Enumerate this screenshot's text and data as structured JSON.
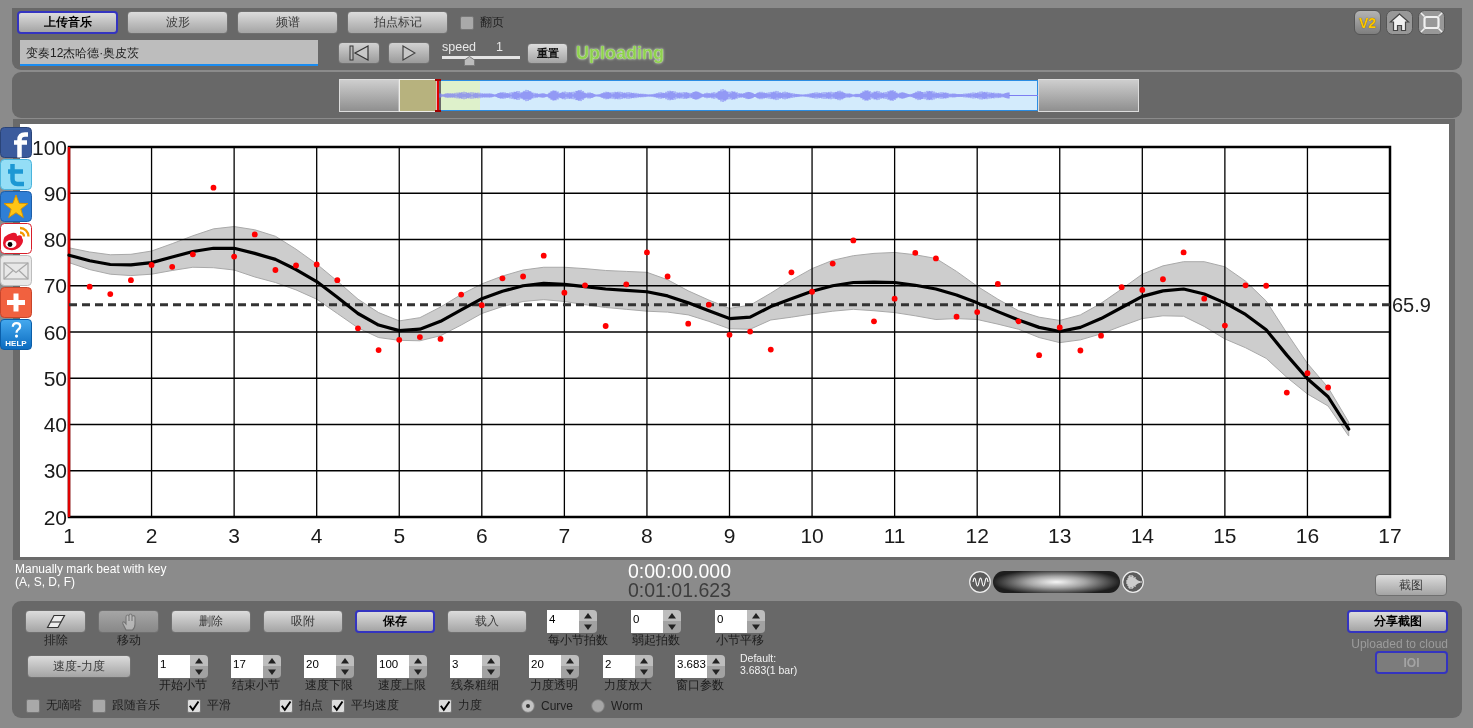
{
  "toolbar": {
    "tabs": [
      {
        "label": "上传音乐",
        "selected": true
      },
      {
        "label": "波形",
        "selected": false
      },
      {
        "label": "频谱",
        "selected": false
      },
      {
        "label": "拍点标记",
        "selected": false
      }
    ],
    "page_flip": {
      "label": "翻页",
      "checked": false
    },
    "version_label": "V2"
  },
  "track": {
    "title": "变奏12杰哈德·奥皮茨",
    "speed_label": "speed",
    "speed_value": "1",
    "speed": {
      "level": 0.33
    },
    "reset_label": "重置",
    "status": "Uploading"
  },
  "social_bar": {
    "help_caption": "HELP"
  },
  "chart": {
    "chart_data": {
      "type": "scatter",
      "grid": true,
      "xlim": [
        1,
        17
      ],
      "ylim": [
        20,
        100
      ],
      "xticks": [
        1,
        2,
        3,
        4,
        5,
        6,
        7,
        8,
        9,
        10,
        11,
        12,
        13,
        14,
        15,
        16,
        17
      ],
      "yticks": [
        20,
        30,
        40,
        50,
        60,
        70,
        80,
        90,
        100
      ],
      "x": [
        1,
        1.25,
        1.5,
        1.75,
        2,
        2.25,
        2.5,
        2.75,
        3,
        3.25,
        3.5,
        3.75,
        4,
        4.25,
        4.5,
        4.75,
        5,
        5.25,
        5.5,
        5.75,
        6,
        6.25,
        6.5,
        6.75,
        7,
        7.25,
        7.5,
        7.75,
        8,
        8.25,
        8.5,
        8.75,
        9,
        9.25,
        9.5,
        9.75,
        10,
        10.25,
        10.5,
        10.75,
        11,
        11.25,
        11.5,
        11.75,
        12,
        12.25,
        12.5,
        12.75,
        13,
        13.25,
        13.5,
        13.75,
        14,
        14.25,
        14.5,
        14.75,
        15,
        15.25,
        15.5,
        15.75,
        16,
        16.25,
        16.5
      ],
      "series": [
        {
          "type": "line",
          "color": "#000000",
          "values": [
            76.6,
            75.4,
            74.6,
            74.5,
            75.0,
            76.2,
            77.4,
            78.1,
            78.1,
            77.0,
            75.7,
            73.5,
            70.9,
            67.5,
            64.0,
            61.5,
            60.3,
            60.6,
            62.3,
            64.8,
            67.2,
            68.8,
            70.0,
            70.5,
            70.3,
            69.8,
            69.3,
            69.0,
            68.7,
            67.8,
            66.3,
            64.6,
            62.9,
            63.2,
            65.5,
            67.2,
            68.8,
            70.0,
            70.7,
            70.8,
            70.7,
            70.1,
            69.3,
            68.0,
            66.3,
            64.4,
            62.6,
            61.0,
            60.1,
            61.0,
            62.9,
            65.3,
            67.7,
            68.9,
            69.3,
            68.2,
            66.3,
            63.8,
            60.5,
            55.0,
            49.9,
            46.0,
            39.0
          ]
        },
        {
          "color": "#ff0000",
          "values": [
            null,
            69.8,
            68.2,
            71.2,
            74.5,
            74.1,
            76.8,
            91.2,
            76.3,
            81.1,
            73.4,
            74.4,
            74.6,
            71.2,
            60.8,
            56.1,
            58.3,
            58.9,
            58.5,
            68.1,
            65.8,
            71.6,
            72.0,
            76.5,
            68.5,
            70.1,
            61.3,
            70.3,
            77.2,
            72.0,
            61.8,
            65.9,
            59.4,
            60.1,
            56.2,
            72.9,
            68.7,
            74.8,
            79.8,
            62.3,
            67.2,
            77.1,
            75.9,
            63.3,
            64.3,
            70.4,
            62.3,
            55.0,
            61.0,
            56.0,
            59.2,
            69.7,
            69.1,
            71.4,
            77.2,
            67.2,
            61.4,
            70.1,
            70.0,
            46.9,
            51.1,
            48.0,
            null
          ]
        }
      ],
      "ref_lines": [
        {
          "axis": "y",
          "value": 65.9,
          "label": "65.9"
        }
      ]
    }
  },
  "hint": "Manually mark beat with key\n(A, S, D, F)",
  "time": {
    "current": "0:00:00.000",
    "total": "0:01:01.623"
  },
  "screenshot_label": "截图",
  "controls": {
    "tools": [
      {
        "label": "排除",
        "disabled": false
      },
      {
        "label": "移动",
        "disabled": true
      }
    ],
    "actions": [
      {
        "label": "删除",
        "selected": false
      },
      {
        "label": "吸附",
        "selected": false
      },
      {
        "label": "保存",
        "selected": true
      },
      {
        "label": "载入",
        "selected": false
      }
    ],
    "bar_settings": [
      {
        "value": "4",
        "label": "每小节拍数"
      },
      {
        "value": "0",
        "label": "弱起拍数"
      },
      {
        "value": "0",
        "label": "小节平移"
      }
    ],
    "mode_label": "速度-力度",
    "view_settings": [
      {
        "value": "1",
        "label": "开始小节"
      },
      {
        "value": "17",
        "label": "结束小节"
      },
      {
        "value": "20",
        "label": "速度下限"
      },
      {
        "value": "100",
        "label": "速度上限"
      },
      {
        "value": "3",
        "label": "线条粗细"
      },
      {
        "value": "20",
        "label": "力度透明"
      },
      {
        "value": "2",
        "label": "力度放大"
      },
      {
        "value": "3.683",
        "label": "窗口参数"
      }
    ],
    "default_note": "Default:\n3.683(1 bar)",
    "options": [
      {
        "kind": "checkbox",
        "label": "无嘀嗒",
        "checked": false
      },
      {
        "kind": "checkbox",
        "label": "跟随音乐",
        "checked": false
      },
      {
        "kind": "checkbox",
        "label": "平滑",
        "checked": true
      },
      {
        "kind": "checkbox",
        "label": "拍点",
        "checked": true
      },
      {
        "kind": "checkbox",
        "label": "平均速度",
        "checked": true
      },
      {
        "kind": "checkbox",
        "label": "力度",
        "checked": true
      },
      {
        "kind": "radio",
        "label": "Curve",
        "selected": true
      },
      {
        "kind": "radio",
        "label": "Worm",
        "selected": false
      }
    ]
  },
  "cloud": {
    "share_button": {
      "label": "分享截图",
      "selected": true
    },
    "status": "Uploaded to cloud",
    "ioi_button": {
      "label": "IOI",
      "selected": true,
      "disabled": true
    }
  }
}
